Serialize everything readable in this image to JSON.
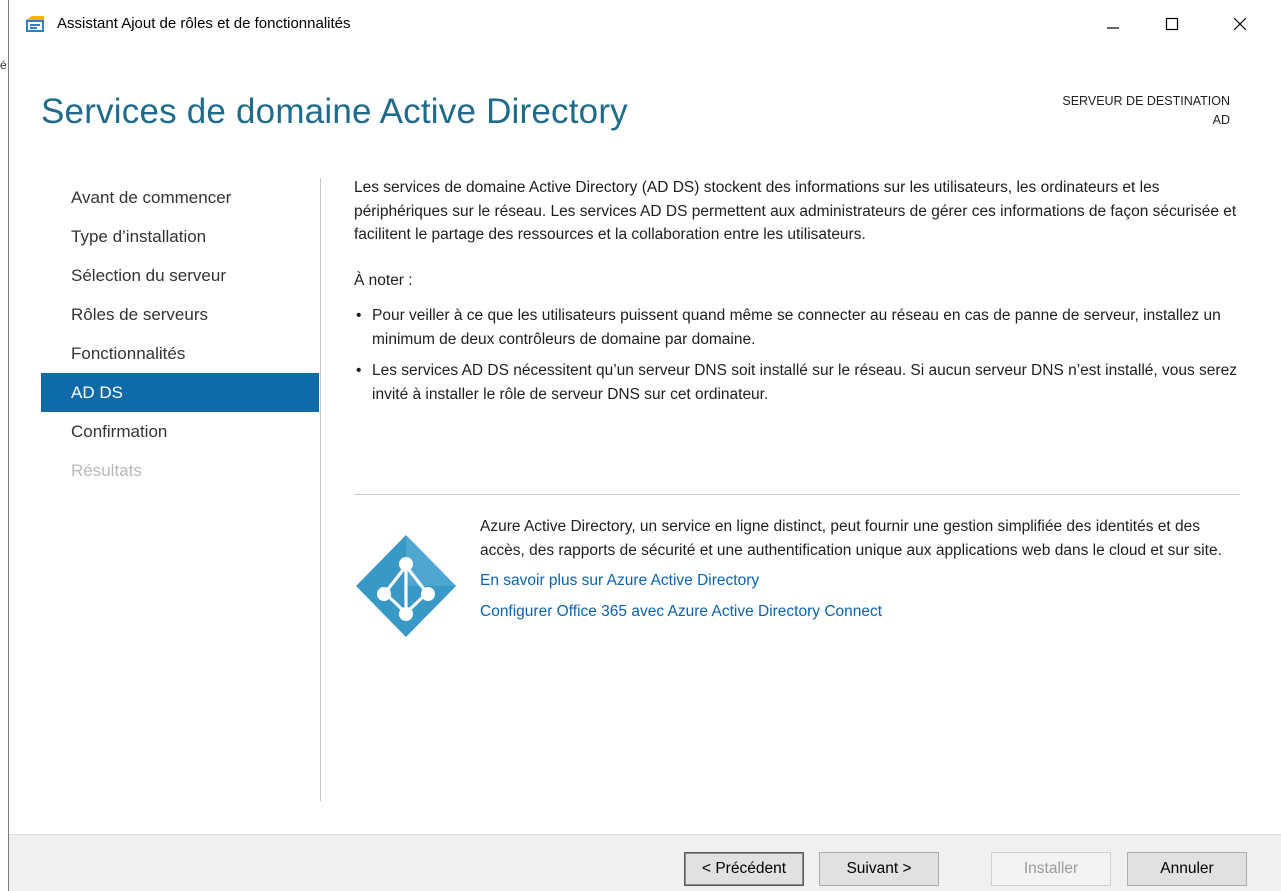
{
  "window": {
    "title": "Assistant Ajout de rôles et de fonctionnalités",
    "outside_char": "é"
  },
  "header": {
    "page_title": "Services de domaine Active Directory",
    "destination_label": "SERVEUR DE DESTINATION",
    "destination_value": "AD"
  },
  "nav": {
    "items": [
      {
        "label": "Avant de commencer",
        "state": "normal"
      },
      {
        "label": "Type d’installation",
        "state": "normal"
      },
      {
        "label": "Sélection du serveur",
        "state": "normal"
      },
      {
        "label": "Rôles de serveurs",
        "state": "normal"
      },
      {
        "label": "Fonctionnalités",
        "state": "normal"
      },
      {
        "label": "AD DS",
        "state": "active"
      },
      {
        "label": "Confirmation",
        "state": "normal"
      },
      {
        "label": "Résultats",
        "state": "disabled"
      }
    ]
  },
  "content": {
    "intro": "Les services de domaine Active Directory (AD DS) stockent des informations sur les utilisateurs, les ordinateurs et les périphériques sur le réseau. Les services AD DS permettent aux administrateurs de gérer ces informations de façon sécurisée et facilitent le partage des ressources et la collaboration entre les utilisateurs.",
    "note_title": "À noter :",
    "bullet_char": "•",
    "bullets": [
      "Pour veiller à ce que les utilisateurs puissent quand même se connecter au réseau en cas de panne de serveur, installez un minimum de deux contrôleurs de domaine par domaine.",
      "Les services AD DS nécessitent qu’un serveur DNS soit installé sur le réseau. Si aucun serveur DNS n’est installé, vous serez invité à installer le rôle de serveur DNS sur cet ordinateur."
    ]
  },
  "azure": {
    "description": "Azure Active Directory, un service en ligne distinct, peut fournir une gestion simplifiée des identités et des accès, des rapports de sécurité et une authentification unique aux applications web dans le cloud et sur site.",
    "link_learn": "En savoir plus sur Azure Active Directory",
    "link_configure": "Configurer Office 365 avec Azure Active Directory Connect"
  },
  "footer": {
    "prev_label": "< Précédent",
    "next_label": "Suivant >",
    "install_label": "Installer",
    "cancel_label": "Annuler"
  },
  "colors": {
    "accent": "#0e6aa8",
    "title_blue": "#1f6b8c",
    "link": "#0b63b0",
    "azure_blue": "#3999c6",
    "footer_bg": "#f0f0f0"
  }
}
